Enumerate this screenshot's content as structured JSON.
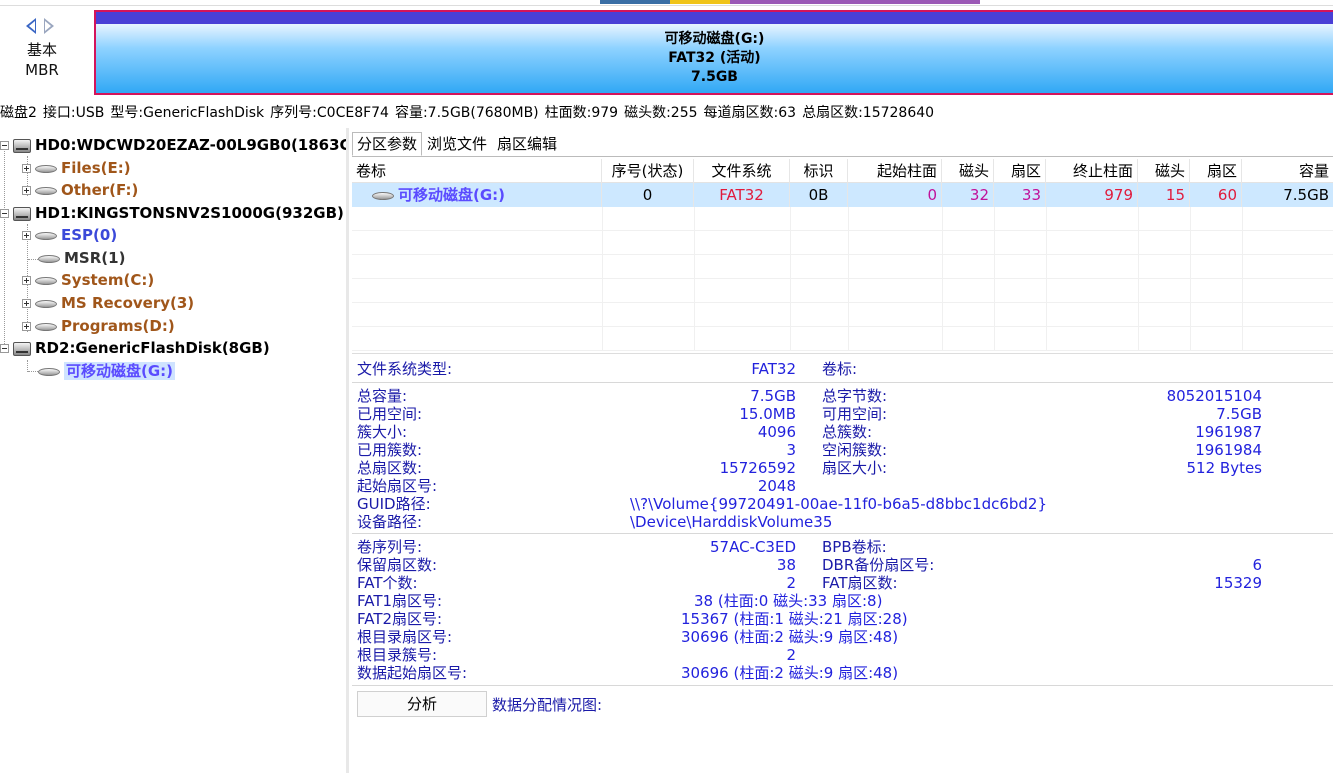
{
  "nav": {
    "kind_line1": "基本",
    "kind_line2": "MBR"
  },
  "partition_bar": {
    "line1": "可移动磁盘(G:)",
    "line2": "FAT32 (活动)",
    "line3": "7.5GB"
  },
  "disk_info": {
    "disk": "磁盘2",
    "iface": "接口:USB",
    "model": "型号:GenericFlashDisk",
    "serial": "序列号:C0CE8F74",
    "capacity": "容量:7.5GB(7680MB)",
    "cylinders": "柱面数:979",
    "heads": "磁头数:255",
    "spt": "每道扇区数:63",
    "sectors": "总扇区数:15728640"
  },
  "tree": {
    "hd0": "HD0:WDCWD20EZAZ-00L9GB0(1863G",
    "hd0_parts": [
      "Files(E:)",
      "Other(F:)"
    ],
    "hd1": "HD1:KINGSTONSNV2S1000G(932GB)",
    "hd1_parts": [
      "ESP(0)",
      "MSR(1)",
      "System(C:)",
      "MS Recovery(3)",
      "Programs(D:)"
    ],
    "rd2": "RD2:GenericFlashDisk(8GB)",
    "rd2_parts": [
      "可移动磁盘(G:)"
    ]
  },
  "tabs": [
    "分区参数",
    "浏览文件",
    "扇区编辑"
  ],
  "partition_table": {
    "headers": [
      "卷标",
      "序号(状态)",
      "文件系统",
      "标识",
      "起始柱面",
      "磁头",
      "扇区",
      "终止柱面",
      "磁头",
      "扇区",
      "容量"
    ],
    "row": [
      "可移动磁盘(G:)",
      "0",
      "FAT32",
      "0B",
      "0",
      "32",
      "33",
      "979",
      "15",
      "60",
      "7.5GB"
    ]
  },
  "details": {
    "fs_type_label": "文件系统类型:",
    "fs_type": "FAT32",
    "vol_label_label": "卷标:",
    "total_cap_label": "总容量:",
    "total_cap": "7.5GB",
    "total_bytes_label": "总字节数:",
    "total_bytes": "8052015104",
    "used_label": "已用空间:",
    "used": "15.0MB",
    "free_label": "可用空间:",
    "free": "7.5GB",
    "cluster_size_label": "簇大小:",
    "cluster_size": "4096",
    "total_clusters_label": "总簇数:",
    "total_clusters": "1961987",
    "used_clusters_label": "已用簇数:",
    "used_clusters": "3",
    "free_clusters_label": "空闲簇数:",
    "free_clusters": "1961984",
    "total_sectors_label": "总扇区数:",
    "total_sectors": "15726592",
    "sector_size_label": "扇区大小:",
    "sector_size": "512 Bytes",
    "start_sector_label": "起始扇区号:",
    "start_sector": "2048",
    "guid_label": "GUID路径:",
    "guid": "\\\\?\\Volume{99720491-00ae-11f0-b6a5-d8bbc1dc6bd2}",
    "device_label": "设备路径:",
    "device": "\\Device\\HarddiskVolume35",
    "serial_label": "卷序列号:",
    "serial": "57AC-C3ED",
    "bpb_label": "BPB卷标:",
    "reserved_label": "保留扇区数:",
    "reserved": "38",
    "dbr_backup_label": "DBR备份扇区号:",
    "dbr_backup": "6",
    "fat_count_label": "FAT个数:",
    "fat_count": "2",
    "fat_sectors_label": "FAT扇区数:",
    "fat_sectors": "15329",
    "fat1_label": "FAT1扇区号:",
    "fat1": "38 (柱面:0 磁头:33 扇区:8)",
    "fat2_label": "FAT2扇区号:",
    "fat2": "15367 (柱面:1 磁头:21 扇区:28)",
    "root_sector_label": "根目录扇区号:",
    "root_sector": "30696 (柱面:2 磁头:9 扇区:48)",
    "root_cluster_label": "根目录簇号:",
    "root_cluster": "2",
    "data_start_label": "数据起始扇区号:",
    "data_start": "30696 (柱面:2 磁头:9 扇区:48)"
  },
  "analyze_button": "分析",
  "alloc_label": "数据分配情况图:"
}
